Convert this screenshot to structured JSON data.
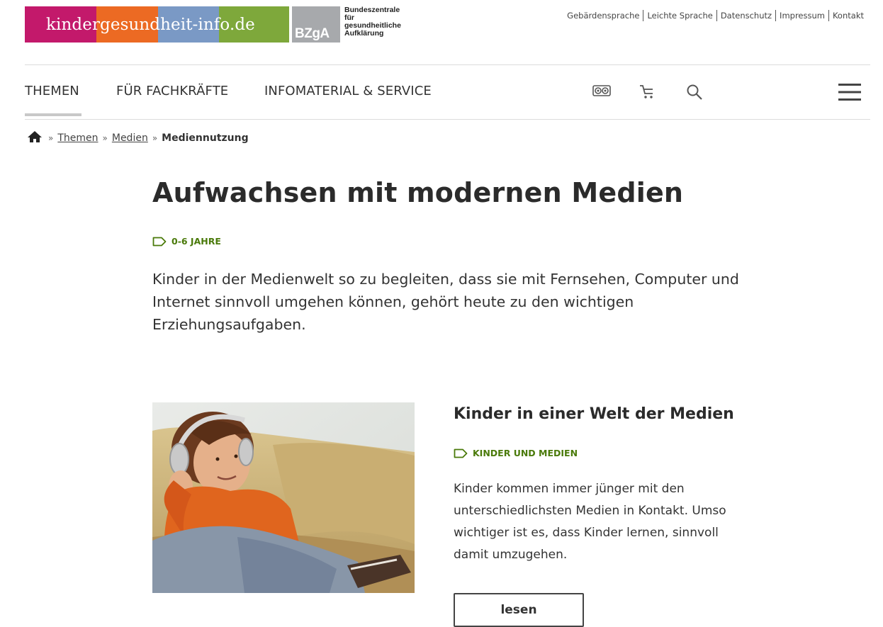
{
  "logo": {
    "site_name": "kindergesundheit-info.de",
    "bzga_abbrev": "BZgA",
    "bzga_name_lines": [
      "Bundeszentrale",
      "für",
      "gesundheitliche",
      "Aufklärung"
    ],
    "colors": [
      "#c3196b",
      "#ec6a23",
      "#7a99c5",
      "#7ea83b",
      "#a7a9ac"
    ]
  },
  "service_links": [
    "Gebärdensprache",
    "Leichte Sprache",
    "Datenschutz",
    "Impressum",
    "Kontakt"
  ],
  "nav": {
    "items": [
      "THEMEN",
      "FÜR FACHKRÄFTE",
      "INFOMATERIAL & SERVICE"
    ],
    "active_item": "THEMEN",
    "icons": [
      "glasses-icon",
      "cart-icon",
      "search-icon",
      "menu-icon"
    ]
  },
  "breadcrumb": {
    "separator": "»",
    "links": [
      "Themen",
      "Medien"
    ],
    "current": "Mediennutzung"
  },
  "main": {
    "title": "Aufwachsen mit modernen Medien",
    "tag": "0-6 JAHRE",
    "lead": "Kinder in der Medienwelt so zu begleiten, dass sie mit Fernsehen, Computer und Internet sinnvoll umgehen können, gehört heute zu den wichtigen Erziehungsaufgaben."
  },
  "teaser": {
    "title": "Kinder in einer Welt der Medien",
    "tag": "KINDER UND MEDIEN",
    "text": "Kinder kommen immer jünger mit den unterschiedlichsten Medien in Kontakt. Umso wichtiger ist es, dass Kinder lernen, sinnvoll damit umzugehen.",
    "button_label": "lesen"
  },
  "accent_color": "#4a7a0a"
}
